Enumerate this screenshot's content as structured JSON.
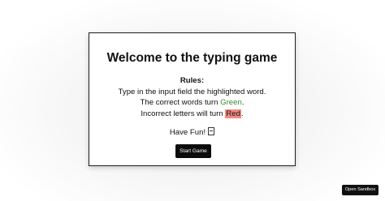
{
  "modal": {
    "title": "Welcome to the typing game",
    "rules_heading": "Rules:",
    "rule_1": "Type in the input field the highlighted word.",
    "rule_2_prefix": "The correct words turn ",
    "rule_2_colored": "Green",
    "rule_2_suffix": ".",
    "rule_3_prefix": "Incorrect letters will turn ",
    "rule_3_colored": "Red",
    "rule_3_suffix": ".",
    "have_fun": "Have Fun!",
    "have_fun_icon": "box-glyph-icon",
    "start_button_label": "Start Game"
  },
  "footer": {
    "sandbox_button_label": "Open Sandbox"
  },
  "colors": {
    "correct_green": "#3a8a2e",
    "incorrect_red_highlight": "#f28b82",
    "button_background": "#0c0c0c"
  }
}
